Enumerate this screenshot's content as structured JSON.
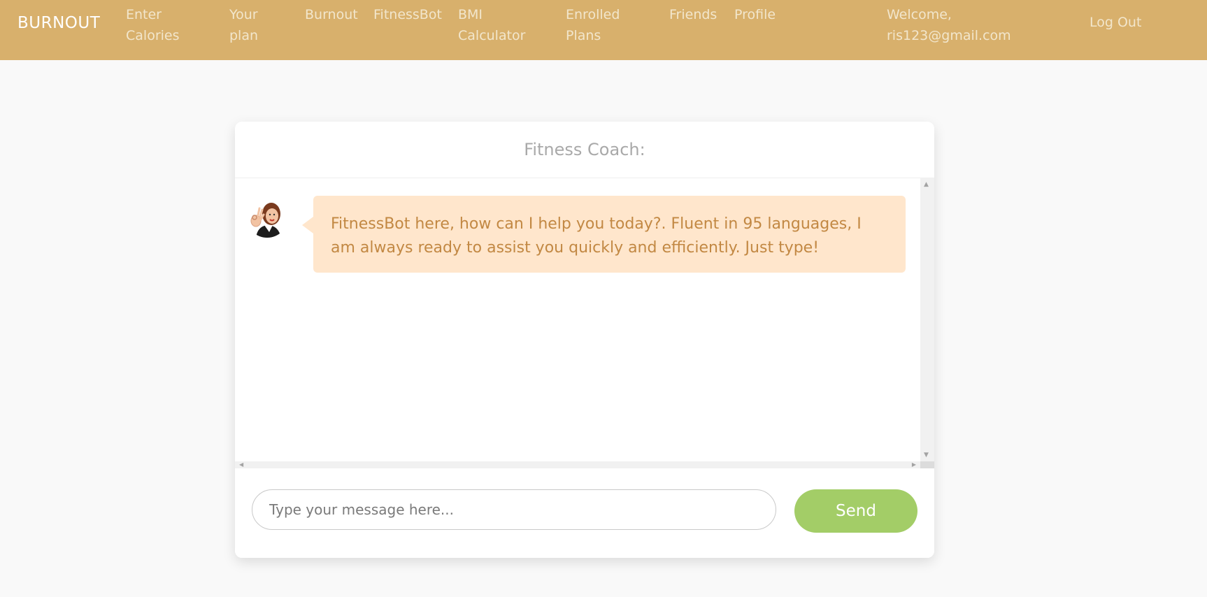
{
  "navbar": {
    "brand": "BURNOUT",
    "links": [
      {
        "line1": "Enter",
        "line2": "Calories"
      },
      {
        "line1": "Your",
        "line2": "plan"
      },
      {
        "line1": "Burnout",
        "line2": ""
      },
      {
        "line1": "FitnessBot",
        "line2": ""
      },
      {
        "line1": "BMI",
        "line2": "Calculator"
      },
      {
        "line1": "Enrolled",
        "line2": "Plans"
      },
      {
        "line1": "Friends",
        "line2": ""
      },
      {
        "line1": "Profile",
        "line2": ""
      }
    ],
    "welcome_line1": "Welcome,",
    "welcome_line2": "ris123@gmail.com",
    "logout": "Log Out"
  },
  "chat": {
    "header": "Fitness Coach:",
    "messages": [
      {
        "text": "FitnessBot here, how can I help you today?. Fluent in 95 languages, I am always ready to assist you quickly and efficiently. Just type!"
      }
    ],
    "input_placeholder": "Type your message here...",
    "send_label": "Send"
  },
  "colors": {
    "navbar_bg": "#d8b06c",
    "bubble_bg": "#ffe6cc",
    "bubble_text": "#c28843",
    "send_bg": "#a3cd67"
  }
}
